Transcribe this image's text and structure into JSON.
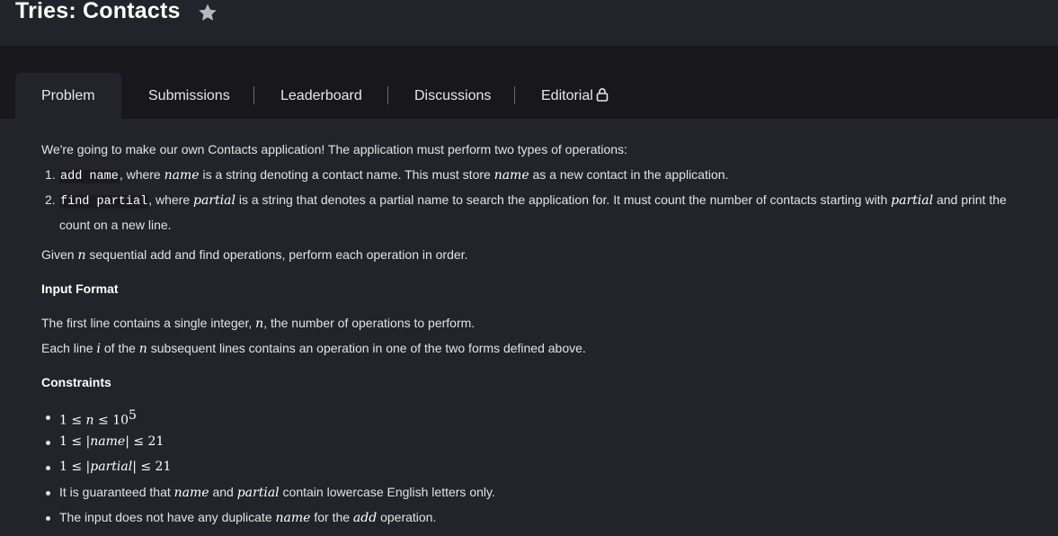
{
  "header": {
    "title": "Tries: Contacts",
    "star_icon": "star-icon"
  },
  "tabs": [
    {
      "label": "Problem",
      "active": true
    },
    {
      "label": "Submissions"
    },
    {
      "label": "Leaderboard"
    },
    {
      "label": "Discussions"
    },
    {
      "label": "Editorial",
      "icon": "lock-icon"
    }
  ],
  "problem": {
    "intro": "We're going to make our own Contacts application! The application must perform two types of operations:",
    "op1": {
      "number": "1.",
      "code": "add name",
      "t1": ", where ",
      "m1": "name",
      "t2": " is a string denoting a contact name. This must store ",
      "m2": "name",
      "t3": " as a new contact in the application."
    },
    "op2": {
      "number": "2.",
      "code": "find partial",
      "t1": ", where ",
      "m1": "partial",
      "t2": " is a string that denotes a partial name to search the application for. It must count the number of contacts starting with ",
      "m2": "partial",
      "t3": " and print the",
      "line2": "count on a new line."
    },
    "given": {
      "t1": "Given ",
      "m1": "n",
      "t2": " sequential add and find operations, perform each operation in order."
    },
    "input_heading": "Input Format",
    "input1": {
      "t1": "The first line contains a single integer, ",
      "m1": "n",
      "t2": ", the number of operations to perform."
    },
    "input2": {
      "t1": "Each line ",
      "m1": "i",
      "t2": " of the ",
      "m2": "n",
      "t3": " subsequent lines contains an operation in one of the two forms defined above."
    },
    "constraints_heading": "Constraints",
    "c1": {
      "a": "1 ≤ ",
      "b": "n",
      "c": " ≤ 10",
      "exp": "5"
    },
    "c2": {
      "a": "1 ≤ |",
      "b": "name",
      "c": "| ≤ 21"
    },
    "c3": {
      "a": "1 ≤ |",
      "b": "partial",
      "c": "| ≤ 21"
    },
    "c4": {
      "t1": "It is guaranteed that ",
      "m1": "name",
      "t2": " and ",
      "m2": "partial",
      "t3": " contain lowercase English letters only."
    },
    "c5": {
      "t1": "The input does not have any duplicate ",
      "m1": "name",
      "t2": " for the ",
      "m2": "add",
      "t3": " operation."
    }
  }
}
